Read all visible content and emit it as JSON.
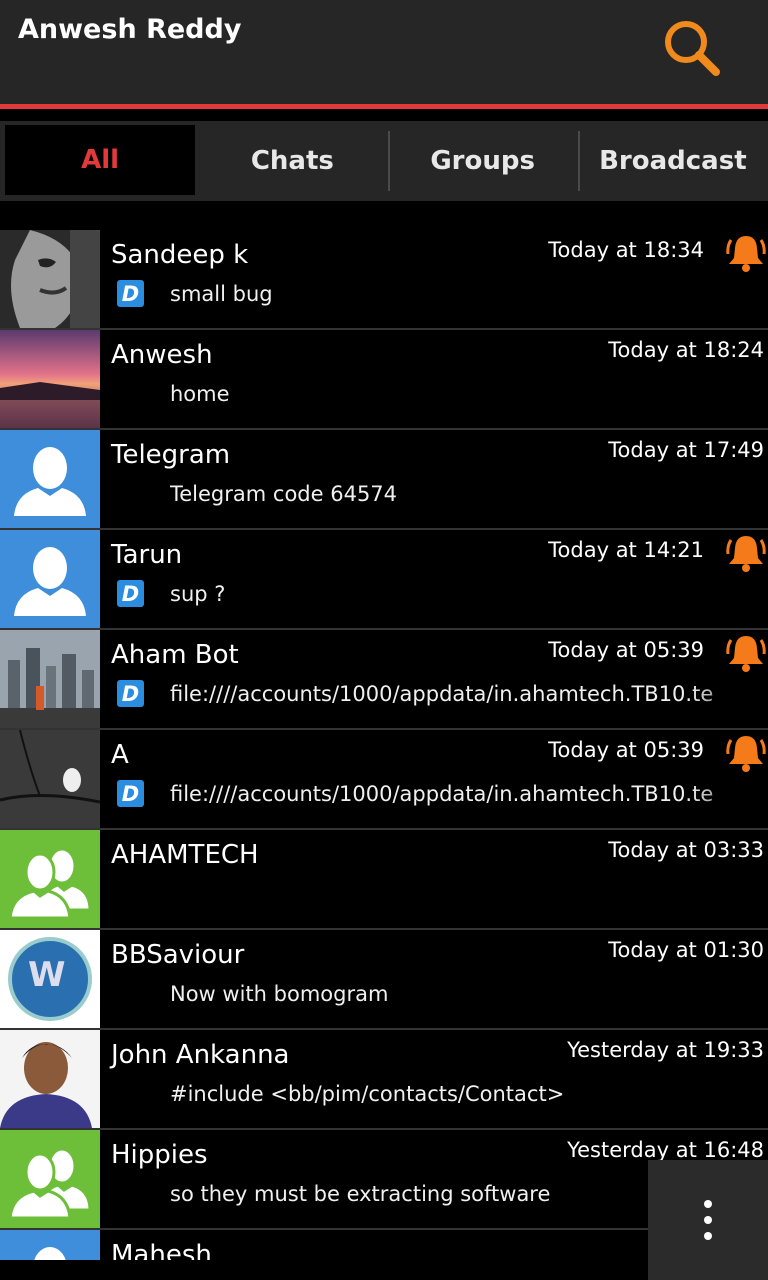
{
  "header": {
    "title": "Anwesh Reddy",
    "search_icon": "search-icon"
  },
  "tabs": [
    {
      "label": "All",
      "active": true
    },
    {
      "label": "Chats",
      "active": false
    },
    {
      "label": "Groups",
      "active": false
    },
    {
      "label": "Broadcast",
      "active": false
    }
  ],
  "conversations": [
    {
      "name": "Sandeep k",
      "time": "Today at 18:34",
      "message": "small bug",
      "delivered_badge": "D",
      "bell": true,
      "avatar": "photo-face"
    },
    {
      "name": "Anwesh",
      "time": "Today at 18:24",
      "message": "home",
      "delivered_badge": "",
      "bell": false,
      "avatar": "photo-sunset"
    },
    {
      "name": "Telegram",
      "time": "Today at 17:49",
      "message": "Telegram code 64574",
      "delivered_badge": "",
      "bell": false,
      "avatar": "default-contact"
    },
    {
      "name": "Tarun",
      "time": "Today at 14:21",
      "message": "sup ?",
      "delivered_badge": "D",
      "bell": true,
      "avatar": "default-contact"
    },
    {
      "name": "Aham Bot",
      "time": "Today at 05:39",
      "message": "file:////accounts/1000/appdata/in.ahamtech.TB10.te",
      "delivered_badge": "D",
      "bell": true,
      "avatar": "photo-city"
    },
    {
      "name": "A",
      "time": "Today at 05:39",
      "message": "file:////accounts/1000/appdata/in.ahamtech.TB10.te",
      "delivered_badge": "D",
      "bell": true,
      "avatar": "photo-owl"
    },
    {
      "name": "AHAMTECH",
      "time": "Today at 03:33",
      "message": "",
      "delivered_badge": "",
      "bell": false,
      "avatar": "default-group"
    },
    {
      "name": "BBSaviour",
      "time": "Today at 01:30",
      "message": "Now with bomogram",
      "delivered_badge": "",
      "bell": false,
      "avatar": "photo-logo"
    },
    {
      "name": "John Ankanna",
      "time": "Yesterday at 19:33",
      "message": "#include <bb/pim/contacts/Contact>",
      "delivered_badge": "",
      "bell": false,
      "avatar": "photo-person"
    },
    {
      "name": "Hippies",
      "time": "Yesterday at 16:48",
      "message": "so they must be extracting software",
      "delivered_badge": "",
      "bell": false,
      "avatar": "default-group"
    },
    {
      "name": "Mahesh",
      "time": "Yesterd",
      "message": "",
      "delivered_badge": "",
      "bell": false,
      "avatar": "default-contact"
    }
  ],
  "overflow_menu_icon": "more-vertical-icon",
  "colors": {
    "accent": "#e23a3a",
    "bell": "#f47a1a",
    "contact_bg": "#3f8edc",
    "group_bg": "#6dbf3a",
    "badge": "#2a8de0"
  }
}
